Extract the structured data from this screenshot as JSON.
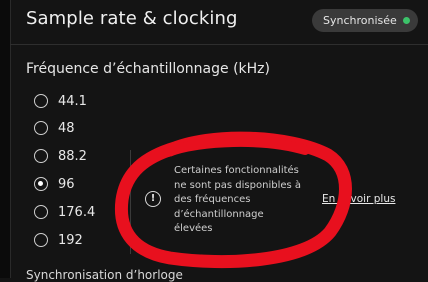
{
  "header": {
    "title": "Sample rate & clocking",
    "status": "Synchronisée",
    "status_color": "#3cc36a"
  },
  "sample_rate": {
    "title": "Fréquence d’échantillonnage (kHz)",
    "options": [
      {
        "label": "44.1",
        "checked": false
      },
      {
        "label": "48",
        "checked": false
      },
      {
        "label": "88.2",
        "checked": false
      },
      {
        "label": "96",
        "checked": true
      },
      {
        "label": "176.4",
        "checked": false
      },
      {
        "label": "192",
        "checked": false
      }
    ]
  },
  "info": {
    "icon": "info-icon",
    "line1": "Certaines fonctionnalités",
    "line2": "ne sont pas disponibles à",
    "line3": "des fréquences",
    "line4": "d’échantillonnage",
    "line5": "élevées",
    "link": "En savoir plus"
  },
  "next_section": {
    "title": "Synchronisation d’horloge"
  },
  "annotation": {
    "color": "#e8101e"
  }
}
